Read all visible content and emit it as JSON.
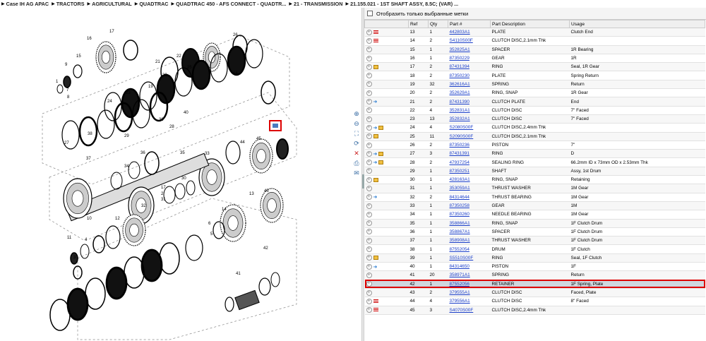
{
  "breadcrumb": [
    "Case IH AG APAC",
    "TRACTORS",
    "AGRICULTURAL",
    "QUADTRAC",
    "QUADTRAC 450 - AFS CONNECT - QUADTR...",
    "21 - TRANSMISSION",
    "21.155.021 - 1ST SHAFT ASSY, 8.5C; (VAR) ..."
  ],
  "filter": {
    "label": "Отобразить только выбранные метки"
  },
  "columns": [
    "Ref",
    "Qty",
    "Part #",
    "Part Description",
    "Usage"
  ],
  "colors": {
    "link": "#1a3ec8",
    "selected_row": "#cfd6de",
    "highlight": "#dd0000"
  },
  "rows": [
    {
      "icons": [
        "flag"
      ],
      "ref": "13",
      "qty": "1",
      "part": "442803A1",
      "desc": "PLATE",
      "usage": "Clutch End"
    },
    {
      "icons": [
        "flag"
      ],
      "ref": "14",
      "qty": "2",
      "part": "S4110S00F",
      "desc": "CLUTCH DISC,2.1mm Thk",
      "usage": ""
    },
    {
      "icons": [],
      "ref": "15",
      "qty": "1",
      "part": "352825A1",
      "desc": "SPACER",
      "usage": "1R Bearing"
    },
    {
      "icons": [],
      "ref": "16",
      "qty": "1",
      "part": "87350229",
      "desc": "GEAR",
      "usage": "1R"
    },
    {
      "icons": [
        "box"
      ],
      "ref": "17",
      "qty": "2",
      "part": "87431394",
      "desc": "RING",
      "usage": "Seal, 1R Gear"
    },
    {
      "icons": [],
      "ref": "18",
      "qty": "2",
      "part": "87350230",
      "desc": "PLATE",
      "usage": "Spring Return"
    },
    {
      "icons": [],
      "ref": "19",
      "qty": "32",
      "part": "362616A1",
      "desc": "SPRING",
      "usage": "Return"
    },
    {
      "icons": [],
      "ref": "20",
      "qty": "2",
      "part": "352629A1",
      "desc": "RING, SNAP",
      "usage": "1R Gear"
    },
    {
      "icons": [
        "arrow"
      ],
      "ref": "21",
      "qty": "2",
      "part": "87431390",
      "desc": "CLUTCH PLATE",
      "usage": "End"
    },
    {
      "icons": [],
      "ref": "22",
      "qty": "4",
      "part": "352831A1",
      "desc": "CLUTCH DISC",
      "usage": "7\" Faced"
    },
    {
      "icons": [],
      "ref": "23",
      "qty": "13",
      "part": "352832A1",
      "desc": "CLUTCH DISC",
      "usage": "7\" Faced"
    },
    {
      "icons": [
        "arrow",
        "box"
      ],
      "ref": "24",
      "qty": "4",
      "part": "S2080S00F",
      "desc": "CLUTCH DISC,2.4mm Thk",
      "usage": ""
    },
    {
      "icons": [
        "box"
      ],
      "ref": "25",
      "qty": "11",
      "part": "S2090S00F",
      "desc": "CLUTCH DISC,2.1mm Thk",
      "usage": ""
    },
    {
      "icons": [],
      "ref": "26",
      "qty": "2",
      "part": "87350236",
      "desc": "PISTON",
      "usage": "7\""
    },
    {
      "icons": [
        "arrow",
        "box"
      ],
      "ref": "27",
      "qty": "3",
      "part": "87431391",
      "desc": "RING",
      "usage": "D"
    },
    {
      "icons": [
        "arrow",
        "box"
      ],
      "ref": "28",
      "qty": "2",
      "part": "47937254",
      "desc": "SEALING RING",
      "usage": "66.2mm ID x 73mm OD x 2.53mm Thk"
    },
    {
      "icons": [],
      "ref": "29",
      "qty": "1",
      "part": "87350251",
      "desc": "SHAFT",
      "usage": "Assy, 1st Drum"
    },
    {
      "icons": [
        "box"
      ],
      "ref": "30",
      "qty": "1",
      "part": "428163A1",
      "desc": "RING, SNAP",
      "usage": "Retaining"
    },
    {
      "icons": [],
      "ref": "31",
      "qty": "1",
      "part": "353059A1",
      "desc": "THRUST WASHER",
      "usage": "1M Gear"
    },
    {
      "icons": [
        "arrow"
      ],
      "ref": "32",
      "qty": "2",
      "part": "84314644",
      "desc": "THRUST BEARING",
      "usage": "1M Gear"
    },
    {
      "icons": [],
      "ref": "33",
      "qty": "1",
      "part": "87350258",
      "desc": "GEAR",
      "usage": "1M"
    },
    {
      "icons": [],
      "ref": "34",
      "qty": "1",
      "part": "87350260",
      "desc": "NEEDLE BEARING",
      "usage": "1M Gear"
    },
    {
      "icons": [],
      "ref": "35",
      "qty": "1",
      "part": "358866A1",
      "desc": "RING, SNAP",
      "usage": "1F Clutch Drum"
    },
    {
      "icons": [],
      "ref": "36",
      "qty": "1",
      "part": "358867A1",
      "desc": "SPACER",
      "usage": "1F Clutch Drum"
    },
    {
      "icons": [],
      "ref": "37",
      "qty": "1",
      "part": "358908A1",
      "desc": "THRUST WASHER",
      "usage": "1F Clutch Drum"
    },
    {
      "icons": [],
      "ref": "38",
      "qty": "1",
      "part": "87552054",
      "desc": "DRUM",
      "usage": "1F Clutch"
    },
    {
      "icons": [
        "box"
      ],
      "ref": "39",
      "qty": "1",
      "part": "S5510S00F",
      "desc": "RING",
      "usage": "Seal, 1F Clutch"
    },
    {
      "icons": [
        "arrow"
      ],
      "ref": "40",
      "qty": "1",
      "part": "84314650",
      "desc": "PISTON",
      "usage": "1F"
    },
    {
      "icons": [],
      "ref": "41",
      "qty": "20",
      "part": "358971A1",
      "desc": "SPRING",
      "usage": "Return"
    },
    {
      "icons": [],
      "ref": "42",
      "qty": "1",
      "part": "87552056",
      "desc": "RETAINER",
      "usage": "1F Spring, Plate",
      "selected": true
    },
    {
      "icons": [],
      "ref": "43",
      "qty": "2",
      "part": "379555A1",
      "desc": "CLUTCH DISC",
      "usage": "Faced, Plate"
    },
    {
      "icons": [
        "flag"
      ],
      "ref": "44",
      "qty": "4",
      "part": "379556A1",
      "desc": "CLUTCH DISC",
      "usage": "8\" Faced"
    },
    {
      "icons": [
        "flag"
      ],
      "ref": "45",
      "qty": "3",
      "part": "S4070S00F",
      "desc": "CLUTCH DISC,2.4mm Thk",
      "usage": ""
    }
  ],
  "diagram": {
    "callouts": [
      "17",
      "16",
      "15",
      "9",
      "1",
      "7",
      "8",
      "26",
      "22",
      "21",
      "25",
      "20",
      "18",
      "19",
      "23",
      "24",
      "40",
      "39",
      "28",
      "29",
      "38",
      "27",
      "37",
      "36",
      "35",
      "34",
      "33",
      "30",
      "17",
      "2",
      "31",
      "32",
      "12",
      "10",
      "11",
      "4",
      "3",
      "5",
      "6",
      "14",
      "13",
      "43",
      "44",
      "45",
      "42",
      "41"
    ]
  },
  "toolbar": [
    "zoom-in-icon",
    "zoom-out-icon",
    "fit-icon",
    "rotate-icon",
    "cross-icon",
    "print-icon",
    "email-icon"
  ]
}
